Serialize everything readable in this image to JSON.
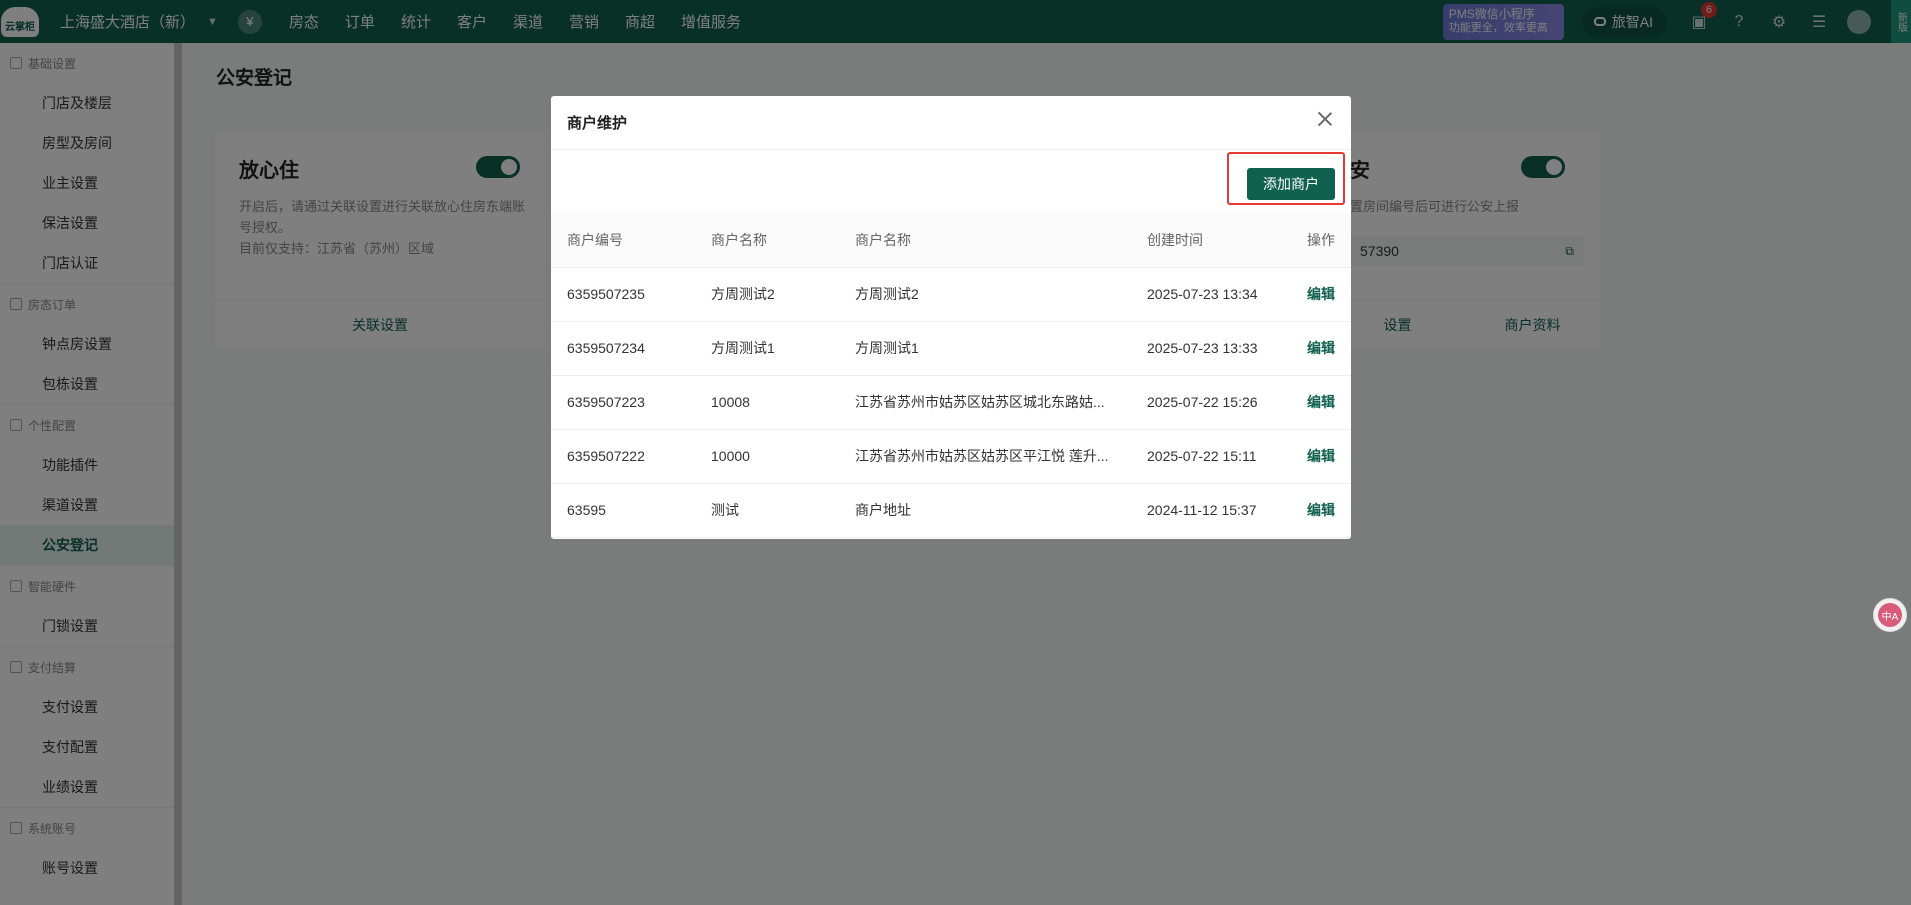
{
  "topbar": {
    "logo_text": "云掌柜",
    "store_name": "上海盛大酒店（新）",
    "yen_icon": "¥",
    "nav": [
      "房态",
      "订单",
      "统计",
      "客户",
      "渠道",
      "营销",
      "商超",
      "增值服务"
    ],
    "promo_line1": "PMS微信小程序",
    "promo_line2": "功能更全，效率更高",
    "ai_label": "旅智AI",
    "message_badge": "6",
    "new_tag": "新版"
  },
  "sidebar": {
    "sections": [
      {
        "title": "基础设置",
        "items": [
          "门店及楼层",
          "房型及房间",
          "业主设置",
          "保洁设置",
          "门店认证"
        ]
      },
      {
        "title": "房态订单",
        "items": [
          "钟点房设置",
          "包栋设置"
        ]
      },
      {
        "title": "个性配置",
        "items": [
          "功能插件",
          "渠道设置",
          "公安登记"
        ]
      },
      {
        "title": "智能硬件",
        "items": [
          "门锁设置"
        ]
      },
      {
        "title": "支付结算",
        "items": [
          "支付设置",
          "支付配置",
          "业绩设置"
        ]
      },
      {
        "title": "系统账号",
        "items": [
          "账号设置"
        ]
      }
    ],
    "active_item": "公安登记"
  },
  "main": {
    "page_title": "公安登记",
    "card1": {
      "title": "放心住",
      "desc1": "开启后，请通过关联设置进行关联放心住房东端账号授权。",
      "desc2": "目前仅支持：江苏省（苏州）区域",
      "link": "关联设置"
    },
    "card2": {
      "title_fragment": "安",
      "desc": "置房间编号后可进行公安上报",
      "input_value": "57390",
      "link1": "设置",
      "link2": "商户资料"
    }
  },
  "modal": {
    "title": "商户维护",
    "add_button": "添加商户",
    "columns": [
      "商户编号",
      "商户名称",
      "商户名称",
      "创建时间",
      "操作"
    ],
    "rows": [
      {
        "id": "6359507235",
        "name": "方周测试2",
        "addr": "方周测试2",
        "time": "2025-07-23 13:34",
        "op": "编辑"
      },
      {
        "id": "6359507234",
        "name": "方周测试1",
        "addr": "方周测试1",
        "time": "2025-07-23 13:33",
        "op": "编辑"
      },
      {
        "id": "6359507223",
        "name": "10008",
        "addr": "江苏省苏州市姑苏区姑苏区城北东路姑...",
        "time": "2025-07-22 15:26",
        "op": "编辑"
      },
      {
        "id": "6359507222",
        "name": "10000",
        "addr": "江苏省苏州市姑苏区姑苏区平江悦 莲升...",
        "time": "2025-07-22 15:11",
        "op": "编辑"
      },
      {
        "id": "63595",
        "name": "测试",
        "addr": "商户地址",
        "time": "2024-11-12 15:37",
        "op": "编辑"
      }
    ]
  },
  "float_translate": "中A"
}
